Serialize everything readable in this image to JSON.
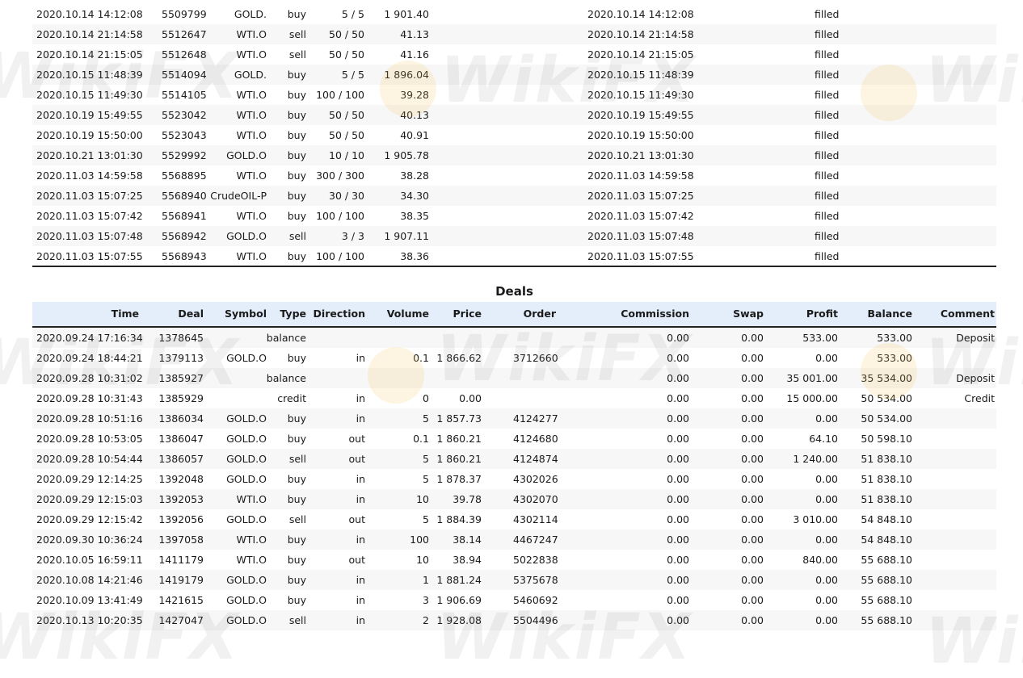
{
  "orders_rows": [
    {
      "time": "2020.10.14 14:12:08",
      "order": "5509799",
      "symbol": "GOLD.",
      "type": "buy",
      "volume": "5 / 5",
      "price": "1 901.40",
      "time_done": "2020.10.14 14:12:08",
      "state": "filled"
    },
    {
      "time": "2020.10.14 21:14:58",
      "order": "5512647",
      "symbol": "WTI.O",
      "type": "sell",
      "volume": "50 / 50",
      "price": "41.13",
      "time_done": "2020.10.14 21:14:58",
      "state": "filled"
    },
    {
      "time": "2020.10.14 21:15:05",
      "order": "5512648",
      "symbol": "WTI.O",
      "type": "sell",
      "volume": "50 / 50",
      "price": "41.16",
      "time_done": "2020.10.14 21:15:05",
      "state": "filled"
    },
    {
      "time": "2020.10.15 11:48:39",
      "order": "5514094",
      "symbol": "GOLD.",
      "type": "buy",
      "volume": "5 / 5",
      "price": "1 896.04",
      "time_done": "2020.10.15 11:48:39",
      "state": "filled"
    },
    {
      "time": "2020.10.15 11:49:30",
      "order": "5514105",
      "symbol": "WTI.O",
      "type": "buy",
      "volume": "100 / 100",
      "price": "39.28",
      "time_done": "2020.10.15 11:49:30",
      "state": "filled"
    },
    {
      "time": "2020.10.19 15:49:55",
      "order": "5523042",
      "symbol": "WTI.O",
      "type": "buy",
      "volume": "50 / 50",
      "price": "40.13",
      "time_done": "2020.10.19 15:49:55",
      "state": "filled"
    },
    {
      "time": "2020.10.19 15:50:00",
      "order": "5523043",
      "symbol": "WTI.O",
      "type": "buy",
      "volume": "50 / 50",
      "price": "40.91",
      "time_done": "2020.10.19 15:50:00",
      "state": "filled"
    },
    {
      "time": "2020.10.21 13:01:30",
      "order": "5529992",
      "symbol": "GOLD.O",
      "type": "buy",
      "volume": "10 / 10",
      "price": "1 905.78",
      "time_done": "2020.10.21 13:01:30",
      "state": "filled"
    },
    {
      "time": "2020.11.03 14:59:58",
      "order": "5568895",
      "symbol": "WTI.O",
      "type": "buy",
      "volume": "300 / 300",
      "price": "38.28",
      "time_done": "2020.11.03 14:59:58",
      "state": "filled"
    },
    {
      "time": "2020.11.03 15:07:25",
      "order": "5568940",
      "symbol": "CrudeOIL-P",
      "type": "buy",
      "volume": "30 / 30",
      "price": "34.30",
      "time_done": "2020.11.03 15:07:25",
      "state": "filled"
    },
    {
      "time": "2020.11.03 15:07:42",
      "order": "5568941",
      "symbol": "WTI.O",
      "type": "buy",
      "volume": "100 / 100",
      "price": "38.35",
      "time_done": "2020.11.03 15:07:42",
      "state": "filled"
    },
    {
      "time": "2020.11.03 15:07:48",
      "order": "5568942",
      "symbol": "GOLD.O",
      "type": "sell",
      "volume": "3 / 3",
      "price": "1 907.11",
      "time_done": "2020.11.03 15:07:48",
      "state": "filled"
    },
    {
      "time": "2020.11.03 15:07:55",
      "order": "5568943",
      "symbol": "WTI.O",
      "type": "buy",
      "volume": "100 / 100",
      "price": "38.36",
      "time_done": "2020.11.03 15:07:55",
      "state": "filled"
    }
  ],
  "deals": {
    "title": "Deals",
    "headers": {
      "time": "Time",
      "deal": "Deal",
      "symbol": "Symbol",
      "type": "Type",
      "direction": "Direction",
      "volume": "Volume",
      "price": "Price",
      "order": "Order",
      "commission": "Commission",
      "swap": "Swap",
      "profit": "Profit",
      "balance": "Balance",
      "comment": "Comment"
    },
    "rows": [
      {
        "time": "2020.09.24 17:16:34",
        "deal": "1378645",
        "symbol": "",
        "type": "balance",
        "direction": "",
        "volume": "",
        "price": "",
        "order": "",
        "commission": "0.00",
        "swap": "0.00",
        "profit": "533.00",
        "balance": "533.00",
        "comment": "Deposit"
      },
      {
        "time": "2020.09.24 18:44:21",
        "deal": "1379113",
        "symbol": "GOLD.O",
        "type": "buy",
        "direction": "in",
        "volume": "0.1",
        "price": "1 866.62",
        "order": "3712660",
        "commission": "0.00",
        "swap": "0.00",
        "profit": "0.00",
        "balance": "533.00",
        "comment": ""
      },
      {
        "time": "2020.09.28 10:31:02",
        "deal": "1385927",
        "symbol": "",
        "type": "balance",
        "direction": "",
        "volume": "",
        "price": "",
        "order": "",
        "commission": "0.00",
        "swap": "0.00",
        "profit": "35 001.00",
        "balance": "35 534.00",
        "comment": "Deposit"
      },
      {
        "time": "2020.09.28 10:31:43",
        "deal": "1385929",
        "symbol": "",
        "type": "credit",
        "direction": "in",
        "volume": "0",
        "price": "0.00",
        "order": "",
        "commission": "0.00",
        "swap": "0.00",
        "profit": "15 000.00",
        "balance": "50 534.00",
        "comment": "Credit"
      },
      {
        "time": "2020.09.28 10:51:16",
        "deal": "1386034",
        "symbol": "GOLD.O",
        "type": "buy",
        "direction": "in",
        "volume": "5",
        "price": "1 857.73",
        "order": "4124277",
        "commission": "0.00",
        "swap": "0.00",
        "profit": "0.00",
        "balance": "50 534.00",
        "comment": ""
      },
      {
        "time": "2020.09.28 10:53:05",
        "deal": "1386047",
        "symbol": "GOLD.O",
        "type": "buy",
        "direction": "out",
        "volume": "0.1",
        "price": "1 860.21",
        "order": "4124680",
        "commission": "0.00",
        "swap": "0.00",
        "profit": "64.10",
        "balance": "50 598.10",
        "comment": ""
      },
      {
        "time": "2020.09.28 10:54:44",
        "deal": "1386057",
        "symbol": "GOLD.O",
        "type": "sell",
        "direction": "out",
        "volume": "5",
        "price": "1 860.21",
        "order": "4124874",
        "commission": "0.00",
        "swap": "0.00",
        "profit": "1 240.00",
        "balance": "51 838.10",
        "comment": ""
      },
      {
        "time": "2020.09.29 12:14:25",
        "deal": "1392048",
        "symbol": "GOLD.O",
        "type": "buy",
        "direction": "in",
        "volume": "5",
        "price": "1 878.37",
        "order": "4302026",
        "commission": "0.00",
        "swap": "0.00",
        "profit": "0.00",
        "balance": "51 838.10",
        "comment": ""
      },
      {
        "time": "2020.09.29 12:15:03",
        "deal": "1392053",
        "symbol": "WTI.O",
        "type": "buy",
        "direction": "in",
        "volume": "10",
        "price": "39.78",
        "order": "4302070",
        "commission": "0.00",
        "swap": "0.00",
        "profit": "0.00",
        "balance": "51 838.10",
        "comment": ""
      },
      {
        "time": "2020.09.29 12:15:42",
        "deal": "1392056",
        "symbol": "GOLD.O",
        "type": "sell",
        "direction": "out",
        "volume": "5",
        "price": "1 884.39",
        "order": "4302114",
        "commission": "0.00",
        "swap": "0.00",
        "profit": "3 010.00",
        "balance": "54 848.10",
        "comment": ""
      },
      {
        "time": "2020.09.30 10:36:24",
        "deal": "1397058",
        "symbol": "WTI.O",
        "type": "buy",
        "direction": "in",
        "volume": "100",
        "price": "38.14",
        "order": "4467247",
        "commission": "0.00",
        "swap": "0.00",
        "profit": "0.00",
        "balance": "54 848.10",
        "comment": ""
      },
      {
        "time": "2020.10.05 16:59:11",
        "deal": "1411179",
        "symbol": "WTI.O",
        "type": "buy",
        "direction": "out",
        "volume": "10",
        "price": "38.94",
        "order": "5022838",
        "commission": "0.00",
        "swap": "0.00",
        "profit": "840.00",
        "balance": "55 688.10",
        "comment": ""
      },
      {
        "time": "2020.10.08 14:21:46",
        "deal": "1419179",
        "symbol": "GOLD.O",
        "type": "buy",
        "direction": "in",
        "volume": "1",
        "price": "1 881.24",
        "order": "5375678",
        "commission": "0.00",
        "swap": "0.00",
        "profit": "0.00",
        "balance": "55 688.10",
        "comment": ""
      },
      {
        "time": "2020.10.09 13:41:49",
        "deal": "1421615",
        "symbol": "GOLD.O",
        "type": "buy",
        "direction": "in",
        "volume": "3",
        "price": "1 906.69",
        "order": "5460692",
        "commission": "0.00",
        "swap": "0.00",
        "profit": "0.00",
        "balance": "55 688.10",
        "comment": ""
      },
      {
        "time": "2020.10.13 10:20:35",
        "deal": "1427047",
        "symbol": "GOLD.O",
        "type": "sell",
        "direction": "in",
        "volume": "2",
        "price": "1 928.08",
        "order": "5504496",
        "commission": "0.00",
        "swap": "0.00",
        "profit": "0.00",
        "balance": "55 688.10",
        "comment": ""
      }
    ]
  },
  "watermark": {
    "text": "WikiFX"
  }
}
